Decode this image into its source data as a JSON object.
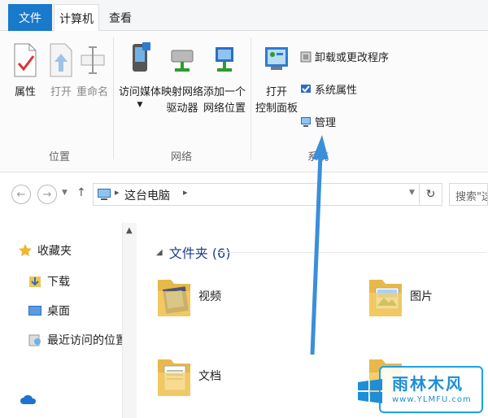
{
  "tabs": {
    "file": "文件",
    "active": "计算机",
    "view": "查看"
  },
  "ribbon": {
    "location": {
      "label": "位置",
      "properties": "属性",
      "open": "打开",
      "rename": "重命名"
    },
    "network": {
      "label": "网络",
      "media_line1": "访问媒体",
      "map_line1": "映射网络",
      "map_line2": "驱动器",
      "add_line1": "添加一个",
      "add_line2": "网络位置"
    },
    "system": {
      "label": "系统",
      "cp_line1": "打开",
      "cp_line2": "控制面板",
      "uninstall": "卸载或更改程序",
      "sysprops": "系统属性",
      "manage": "管理"
    }
  },
  "address": {
    "path": "这台电脑",
    "search_placeholder": "搜索\"这台电脑\""
  },
  "nav": {
    "items": [
      {
        "label": "收藏夹"
      },
      {
        "label": "下载"
      },
      {
        "label": "桌面"
      },
      {
        "label": "最近访问的位置"
      }
    ]
  },
  "content": {
    "section_title": "文件夹 (6)",
    "folders": [
      "视频",
      "图片",
      "文档"
    ]
  },
  "watermark": {
    "title": "雨林木风",
    "url": "www.YLMFU.com"
  },
  "colors": {
    "accent": "#1979ca",
    "arrow": "#3a8fd9",
    "section": "#1e3c8c"
  }
}
